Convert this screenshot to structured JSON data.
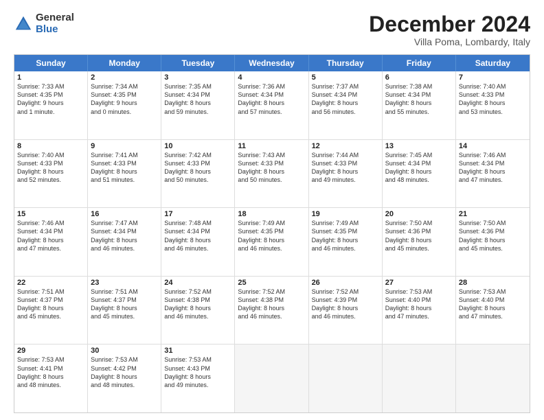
{
  "logo": {
    "general": "General",
    "blue": "Blue"
  },
  "title": "December 2024",
  "location": "Villa Poma, Lombardy, Italy",
  "header_days": [
    "Sunday",
    "Monday",
    "Tuesday",
    "Wednesday",
    "Thursday",
    "Friday",
    "Saturday"
  ],
  "weeks": [
    [
      {
        "day": "1",
        "lines": [
          "Sunrise: 7:33 AM",
          "Sunset: 4:35 PM",
          "Daylight: 9 hours",
          "and 1 minute."
        ]
      },
      {
        "day": "2",
        "lines": [
          "Sunrise: 7:34 AM",
          "Sunset: 4:35 PM",
          "Daylight: 9 hours",
          "and 0 minutes."
        ]
      },
      {
        "day": "3",
        "lines": [
          "Sunrise: 7:35 AM",
          "Sunset: 4:34 PM",
          "Daylight: 8 hours",
          "and 59 minutes."
        ]
      },
      {
        "day": "4",
        "lines": [
          "Sunrise: 7:36 AM",
          "Sunset: 4:34 PM",
          "Daylight: 8 hours",
          "and 57 minutes."
        ]
      },
      {
        "day": "5",
        "lines": [
          "Sunrise: 7:37 AM",
          "Sunset: 4:34 PM",
          "Daylight: 8 hours",
          "and 56 minutes."
        ]
      },
      {
        "day": "6",
        "lines": [
          "Sunrise: 7:38 AM",
          "Sunset: 4:34 PM",
          "Daylight: 8 hours",
          "and 55 minutes."
        ]
      },
      {
        "day": "7",
        "lines": [
          "Sunrise: 7:40 AM",
          "Sunset: 4:33 PM",
          "Daylight: 8 hours",
          "and 53 minutes."
        ]
      }
    ],
    [
      {
        "day": "8",
        "lines": [
          "Sunrise: 7:40 AM",
          "Sunset: 4:33 PM",
          "Daylight: 8 hours",
          "and 52 minutes."
        ]
      },
      {
        "day": "9",
        "lines": [
          "Sunrise: 7:41 AM",
          "Sunset: 4:33 PM",
          "Daylight: 8 hours",
          "and 51 minutes."
        ]
      },
      {
        "day": "10",
        "lines": [
          "Sunrise: 7:42 AM",
          "Sunset: 4:33 PM",
          "Daylight: 8 hours",
          "and 50 minutes."
        ]
      },
      {
        "day": "11",
        "lines": [
          "Sunrise: 7:43 AM",
          "Sunset: 4:33 PM",
          "Daylight: 8 hours",
          "and 50 minutes."
        ]
      },
      {
        "day": "12",
        "lines": [
          "Sunrise: 7:44 AM",
          "Sunset: 4:33 PM",
          "Daylight: 8 hours",
          "and 49 minutes."
        ]
      },
      {
        "day": "13",
        "lines": [
          "Sunrise: 7:45 AM",
          "Sunset: 4:34 PM",
          "Daylight: 8 hours",
          "and 48 minutes."
        ]
      },
      {
        "day": "14",
        "lines": [
          "Sunrise: 7:46 AM",
          "Sunset: 4:34 PM",
          "Daylight: 8 hours",
          "and 47 minutes."
        ]
      }
    ],
    [
      {
        "day": "15",
        "lines": [
          "Sunrise: 7:46 AM",
          "Sunset: 4:34 PM",
          "Daylight: 8 hours",
          "and 47 minutes."
        ]
      },
      {
        "day": "16",
        "lines": [
          "Sunrise: 7:47 AM",
          "Sunset: 4:34 PM",
          "Daylight: 8 hours",
          "and 46 minutes."
        ]
      },
      {
        "day": "17",
        "lines": [
          "Sunrise: 7:48 AM",
          "Sunset: 4:34 PM",
          "Daylight: 8 hours",
          "and 46 minutes."
        ]
      },
      {
        "day": "18",
        "lines": [
          "Sunrise: 7:49 AM",
          "Sunset: 4:35 PM",
          "Daylight: 8 hours",
          "and 46 minutes."
        ]
      },
      {
        "day": "19",
        "lines": [
          "Sunrise: 7:49 AM",
          "Sunset: 4:35 PM",
          "Daylight: 8 hours",
          "and 46 minutes."
        ]
      },
      {
        "day": "20",
        "lines": [
          "Sunrise: 7:50 AM",
          "Sunset: 4:36 PM",
          "Daylight: 8 hours",
          "and 45 minutes."
        ]
      },
      {
        "day": "21",
        "lines": [
          "Sunrise: 7:50 AM",
          "Sunset: 4:36 PM",
          "Daylight: 8 hours",
          "and 45 minutes."
        ]
      }
    ],
    [
      {
        "day": "22",
        "lines": [
          "Sunrise: 7:51 AM",
          "Sunset: 4:37 PM",
          "Daylight: 8 hours",
          "and 45 minutes."
        ]
      },
      {
        "day": "23",
        "lines": [
          "Sunrise: 7:51 AM",
          "Sunset: 4:37 PM",
          "Daylight: 8 hours",
          "and 45 minutes."
        ]
      },
      {
        "day": "24",
        "lines": [
          "Sunrise: 7:52 AM",
          "Sunset: 4:38 PM",
          "Daylight: 8 hours",
          "and 46 minutes."
        ]
      },
      {
        "day": "25",
        "lines": [
          "Sunrise: 7:52 AM",
          "Sunset: 4:38 PM",
          "Daylight: 8 hours",
          "and 46 minutes."
        ]
      },
      {
        "day": "26",
        "lines": [
          "Sunrise: 7:52 AM",
          "Sunset: 4:39 PM",
          "Daylight: 8 hours",
          "and 46 minutes."
        ]
      },
      {
        "day": "27",
        "lines": [
          "Sunrise: 7:53 AM",
          "Sunset: 4:40 PM",
          "Daylight: 8 hours",
          "and 47 minutes."
        ]
      },
      {
        "day": "28",
        "lines": [
          "Sunrise: 7:53 AM",
          "Sunset: 4:40 PM",
          "Daylight: 8 hours",
          "and 47 minutes."
        ]
      }
    ],
    [
      {
        "day": "29",
        "lines": [
          "Sunrise: 7:53 AM",
          "Sunset: 4:41 PM",
          "Daylight: 8 hours",
          "and 48 minutes."
        ]
      },
      {
        "day": "30",
        "lines": [
          "Sunrise: 7:53 AM",
          "Sunset: 4:42 PM",
          "Daylight: 8 hours",
          "and 48 minutes."
        ]
      },
      {
        "day": "31",
        "lines": [
          "Sunrise: 7:53 AM",
          "Sunset: 4:43 PM",
          "Daylight: 8 hours",
          "and 49 minutes."
        ]
      },
      {
        "day": "",
        "lines": []
      },
      {
        "day": "",
        "lines": []
      },
      {
        "day": "",
        "lines": []
      },
      {
        "day": "",
        "lines": []
      }
    ]
  ]
}
